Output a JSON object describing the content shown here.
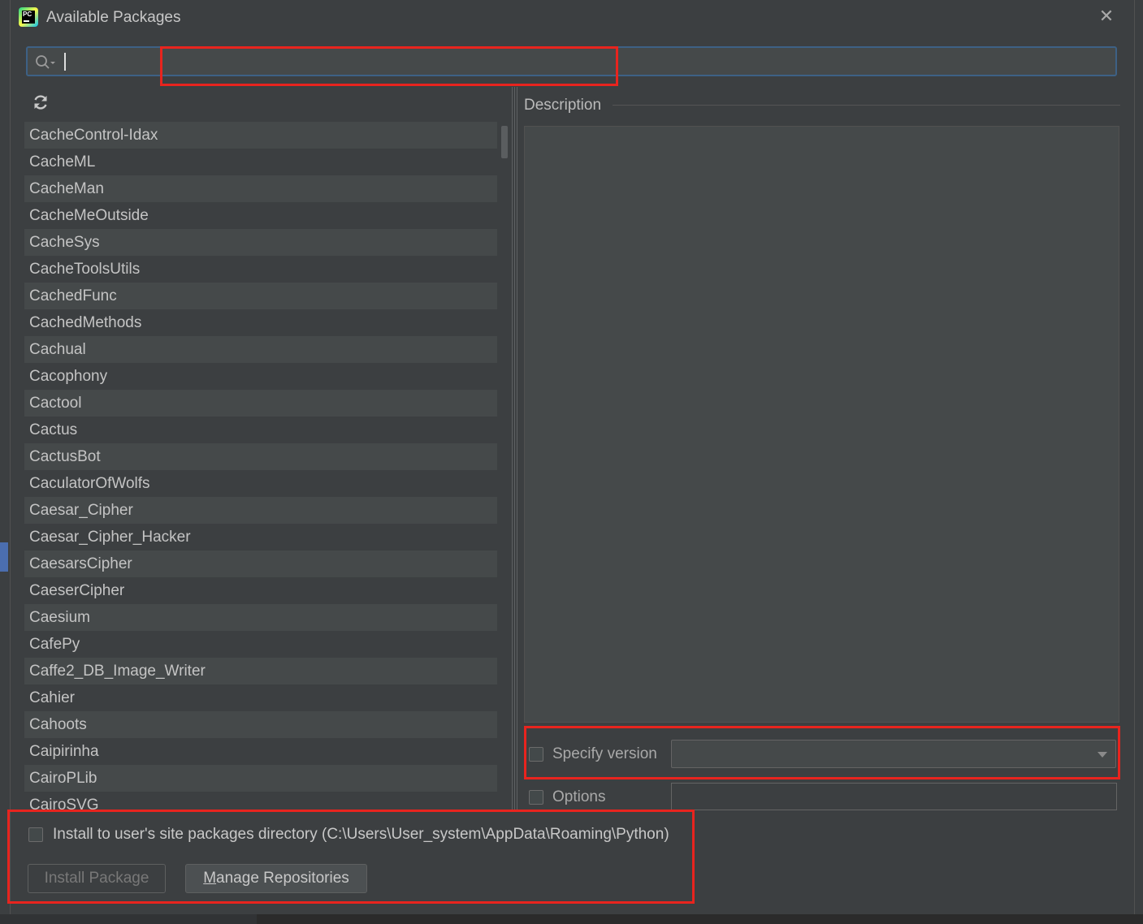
{
  "dialog": {
    "title": "Available Packages",
    "close_glyph": "✕"
  },
  "search": {
    "value": "",
    "placeholder": ""
  },
  "packages": [
    "CacheControl-Idax",
    "CacheML",
    "CacheMan",
    "CacheMeOutside",
    "CacheSys",
    "CacheToolsUtils",
    "CachedFunc",
    "CachedMethods",
    "Cachual",
    "Cacophony",
    "Cactool",
    "Cactus",
    "CactusBot",
    "CaculatorOfWolfs",
    "Caesar_Cipher",
    "Caesar_Cipher_Hacker",
    "CaesarsCipher",
    "CaeserCipher",
    "Caesium",
    "CafePy",
    "Caffe2_DB_Image_Writer",
    "Cahier",
    "Cahoots",
    "Caipirinha",
    "CairoPLib",
    "CairoSVG"
  ],
  "details": {
    "description_label": "Description",
    "specify_version_label": "Specify version",
    "version_value": "",
    "options_label": "Options",
    "options_value": ""
  },
  "footer": {
    "install_user_label": "Install to user's site packages directory (C:\\Users\\User_system\\AppData\\Roaming\\Python)",
    "install_button_label": "Install Package",
    "manage_button_mnemonic": "M",
    "manage_button_rest": "anage Repositories"
  },
  "icons": {
    "app": "pycharm-icon",
    "search": "search-icon",
    "refresh": "refresh-icon",
    "close": "close-icon",
    "dropdown": "chevron-down-icon"
  },
  "colors": {
    "dialog_bg": "#3c3f41",
    "field_bg": "#45494a",
    "focus_border": "#3d6185",
    "annotation_red": "#e8241e"
  }
}
